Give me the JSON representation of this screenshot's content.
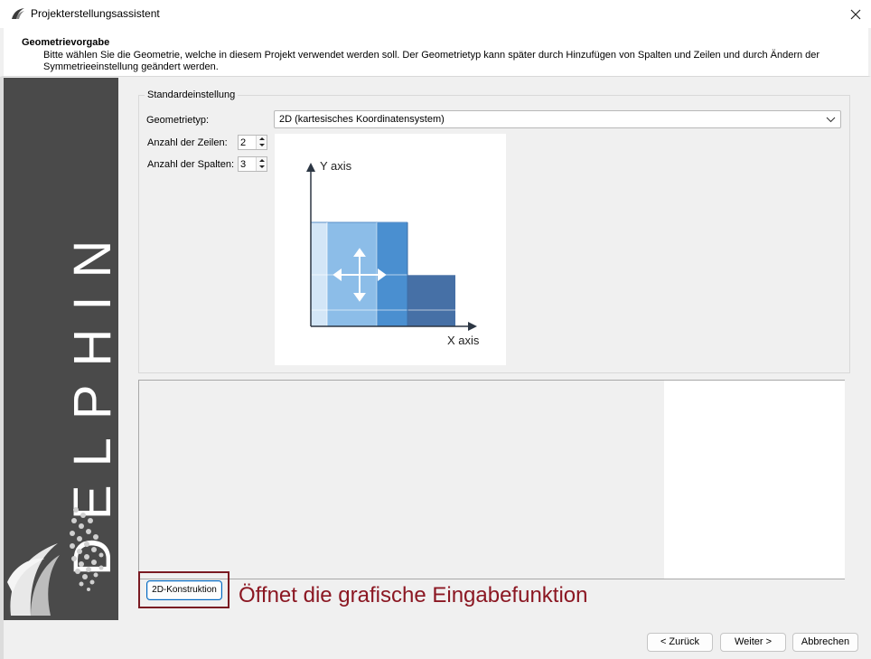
{
  "window": {
    "title": "Projekterstellungsassistent",
    "close_label": "×"
  },
  "header": {
    "title": "Geometrievorgabe",
    "description": "Bitte wählen Sie die Geometrie, welche in diesem Projekt verwendet werden soll. Der Geometrietyp kann später durch Hinzufügen von Spalten und Zeilen und durch Ändern der Symmetrieeinstellung geändert werden."
  },
  "sidebar": {
    "brand": "DELPHIN"
  },
  "settings": {
    "group_title": "Standardeinstellung",
    "geometry_type_label": "Geometrietyp:",
    "geometry_type_value": "2D (kartesisches Koordinatensystem)",
    "rows_label": "Anzahl der Zeilen:",
    "rows_value": "2",
    "columns_label": "Anzahl der Spalten:",
    "columns_value": "3"
  },
  "diagram": {
    "y_axis_label": "Y axis",
    "x_axis_label": "X axis",
    "colors": {
      "light": "#d3e6f7",
      "mid": "#8cbde8",
      "strong": "#4a8fd0",
      "dark": "#4670a6",
      "axis": "#2d3744"
    }
  },
  "construction": {
    "button_label": "2D-Konstruktion",
    "annotation": "Öffnet die grafische Eingabefunktion",
    "annotation_color": "#8b1722"
  },
  "footer": {
    "back_label": "< Zurück",
    "next_label": "Weiter >",
    "cancel_label": "Abbrechen"
  }
}
